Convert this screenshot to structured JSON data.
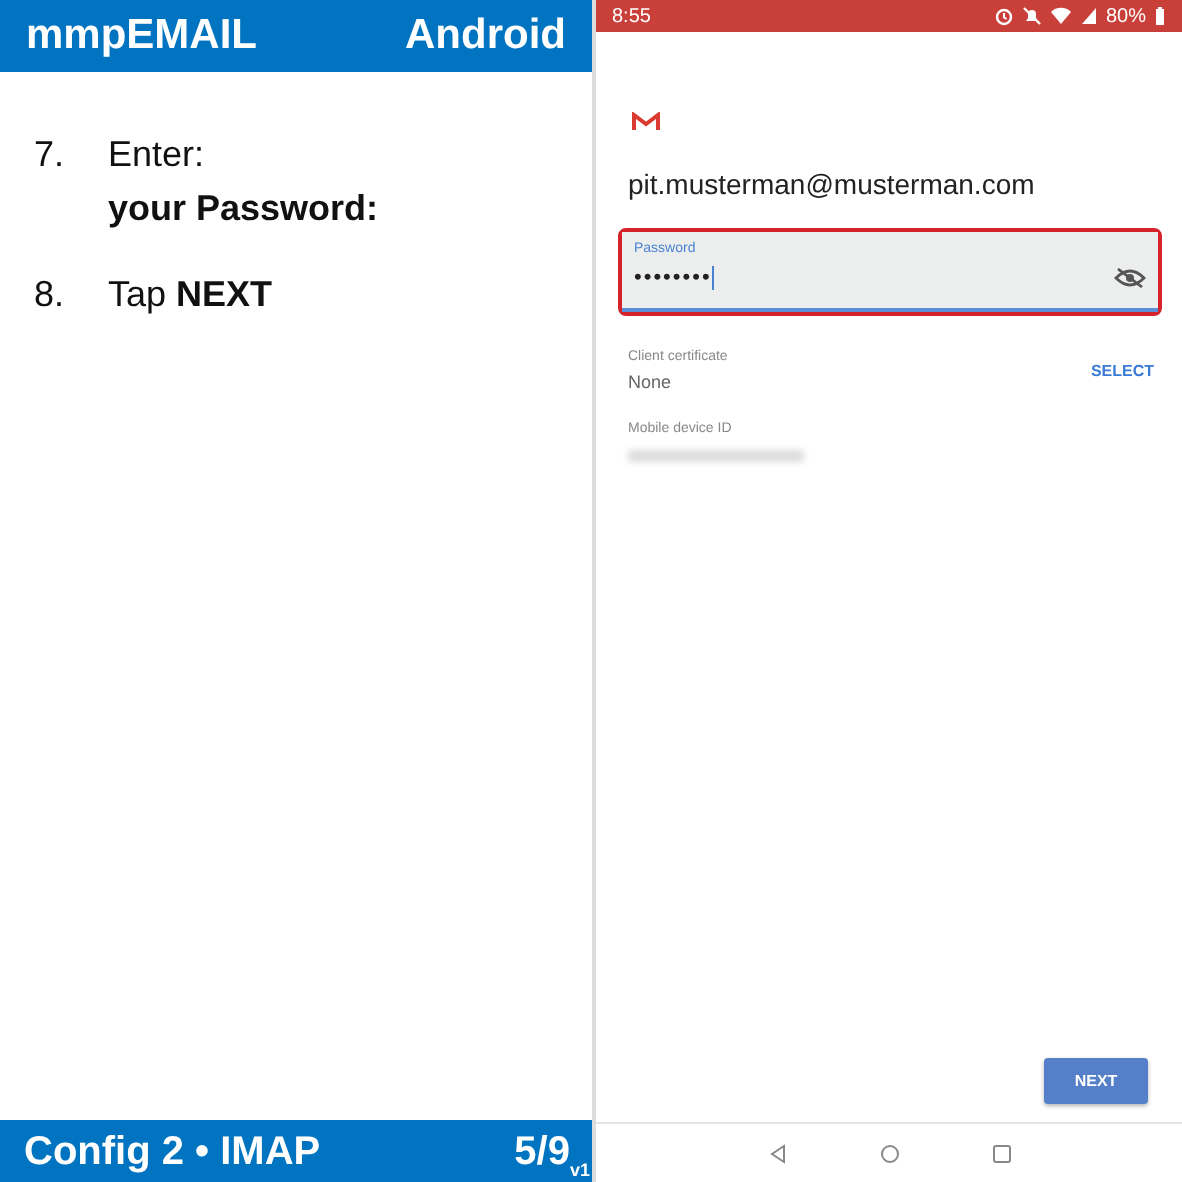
{
  "guide_header": {
    "title": "mmpEMAIL",
    "platform": "Android"
  },
  "steps": [
    {
      "number": "7.",
      "lines": [
        {
          "text": "Enter:",
          "bold": false
        },
        {
          "text": "your Password:",
          "bold": true
        }
      ]
    },
    {
      "number": "8.",
      "lines": [
        {
          "text": "Tap **NEXT**",
          "bold": false
        }
      ]
    }
  ],
  "guide_footer": {
    "section": "Config 2 • IMAP",
    "page": "5/9",
    "version": "v1"
  },
  "phone": {
    "status_bar": {
      "time": "8:55",
      "battery": "80%"
    },
    "account": "pit.musterman@musterman.com",
    "password_field": {
      "label": "Password",
      "value": "••••••••",
      "focused": true,
      "highlighted": true
    },
    "client_certificate": {
      "label": "Client certificate",
      "value": "None",
      "action": "SELECT"
    },
    "device_id": {
      "label": "Mobile device ID"
    },
    "next_button": "NEXT"
  }
}
